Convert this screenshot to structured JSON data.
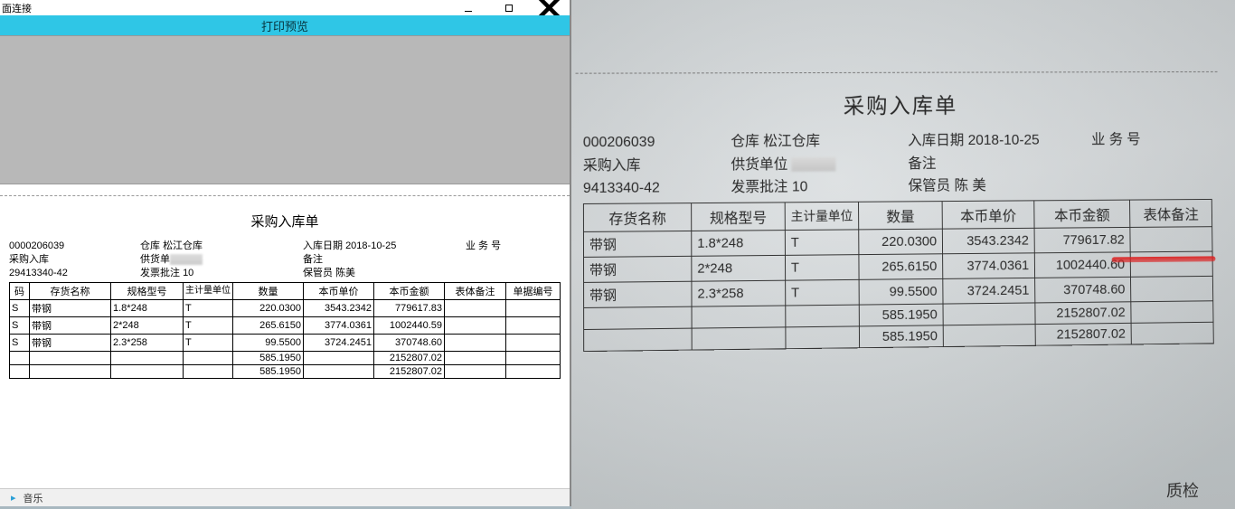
{
  "window": {
    "title_fragment": "面连接",
    "header": "打印预览"
  },
  "status": {
    "text": "音乐",
    "icon_glyph": "▸"
  },
  "doc": {
    "title": "采购入库单",
    "id": "0000206039",
    "type": "采购入库",
    "ref": "29413340-42",
    "warehouse_label": "仓库",
    "warehouse": "松江仓库",
    "supplier_label": "供货单",
    "invoice_label": "发票批注",
    "invoice_batch": "10",
    "in_date_label": "入库日期",
    "in_date": "2018-10-25",
    "remark_label": "备注",
    "keeper_label": "保管员",
    "keeper": "陈美",
    "biz_label": "业 务 号",
    "columns": {
      "code": "码",
      "name": "存货名称",
      "spec": "规格型号",
      "unit": "主计量单位",
      "qty": "数量",
      "price": "本币单价",
      "amount": "本币金额",
      "body_remark": "表体备注",
      "doc_no": "单据编号"
    },
    "rows": [
      {
        "code": "S",
        "name": "带钢",
        "spec": "1.8*248",
        "unit": "T",
        "qty": "220.0300",
        "price": "3543.2342",
        "amount": "779617.83"
      },
      {
        "code": "S",
        "name": "带钢",
        "spec": "2*248",
        "unit": "T",
        "qty": "265.6150",
        "price": "3774.0361",
        "amount": "1002440.59"
      },
      {
        "code": "S",
        "name": "带钢",
        "spec": "2.3*258",
        "unit": "T",
        "qty": "99.5500",
        "price": "3724.2451",
        "amount": "370748.60"
      }
    ],
    "totals": [
      {
        "qty": "585.1950",
        "amount": "2152807.02"
      },
      {
        "qty": "585.1950",
        "amount": "2152807.02"
      }
    ]
  },
  "photo": {
    "title": "采购入库单",
    "id": "000206039",
    "type": "采购入库",
    "ref": "9413340-42",
    "warehouse_label": "仓库",
    "warehouse": "松江仓库",
    "supplier_label": "供货单位",
    "invoice_label": "发票批注",
    "invoice_batch": "10",
    "in_date_label": "入库日期",
    "in_date": "2018-10-25",
    "remark_label": "备注",
    "keeper_label": "保管员",
    "keeper": "陈 美",
    "biz_label": "业 务 号",
    "columns": {
      "name": "存货名称",
      "spec": "规格型号",
      "unit": "主计量单位",
      "qty": "数量",
      "price": "本币单价",
      "amount": "本币金额",
      "body_remark": "表体备注"
    },
    "rows": [
      {
        "name": "带钢",
        "spec": "1.8*248",
        "unit": "T",
        "qty": "220.0300",
        "price": "3543.2342",
        "amount": "779617.82"
      },
      {
        "name": "带钢",
        "spec": "2*248",
        "unit": "T",
        "qty": "265.6150",
        "price": "3774.0361",
        "amount": "1002440.60"
      },
      {
        "name": "带钢",
        "spec": "2.3*258",
        "unit": "T",
        "qty": "99.5500",
        "price": "3724.2451",
        "amount": "370748.60"
      }
    ],
    "totals": [
      {
        "qty": "585.1950",
        "amount": "2152807.02"
      },
      {
        "qty": "585.1950",
        "amount": "2152807.02"
      }
    ],
    "corner": "质检"
  }
}
